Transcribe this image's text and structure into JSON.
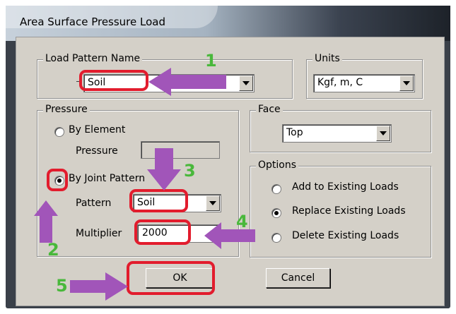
{
  "window": {
    "title": "Area Surface Pressure Load"
  },
  "load_pattern": {
    "group_label": "Load Pattern Name",
    "value": "Soil"
  },
  "units": {
    "group_label": "Units",
    "value": "Kgf, m, C"
  },
  "pressure": {
    "group_label": "Pressure",
    "by_element_label": "By Element",
    "pressure_label": "Pressure",
    "pressure_value": "",
    "by_joint_label": "By Joint Pattern",
    "pattern_label": "Pattern",
    "pattern_value": "Soil",
    "multiplier_label": "Multiplier",
    "multiplier_value": "2000",
    "selected": "By Joint Pattern"
  },
  "face": {
    "group_label": "Face",
    "value": "Top"
  },
  "options": {
    "group_label": "Options",
    "add_label": "Add to Existing Loads",
    "replace_label": "Replace Existing Loads",
    "delete_label": "Delete Existing Loads",
    "selected": "Replace Existing Loads"
  },
  "buttons": {
    "ok": "OK",
    "cancel": "Cancel"
  },
  "annotations": {
    "step1": "1",
    "step2": "2",
    "step3": "3",
    "step4": "4",
    "step5": "5",
    "highlight_color": "#e21c2d",
    "arrow_color": "#a155b9",
    "number_color": "#49b83b"
  }
}
